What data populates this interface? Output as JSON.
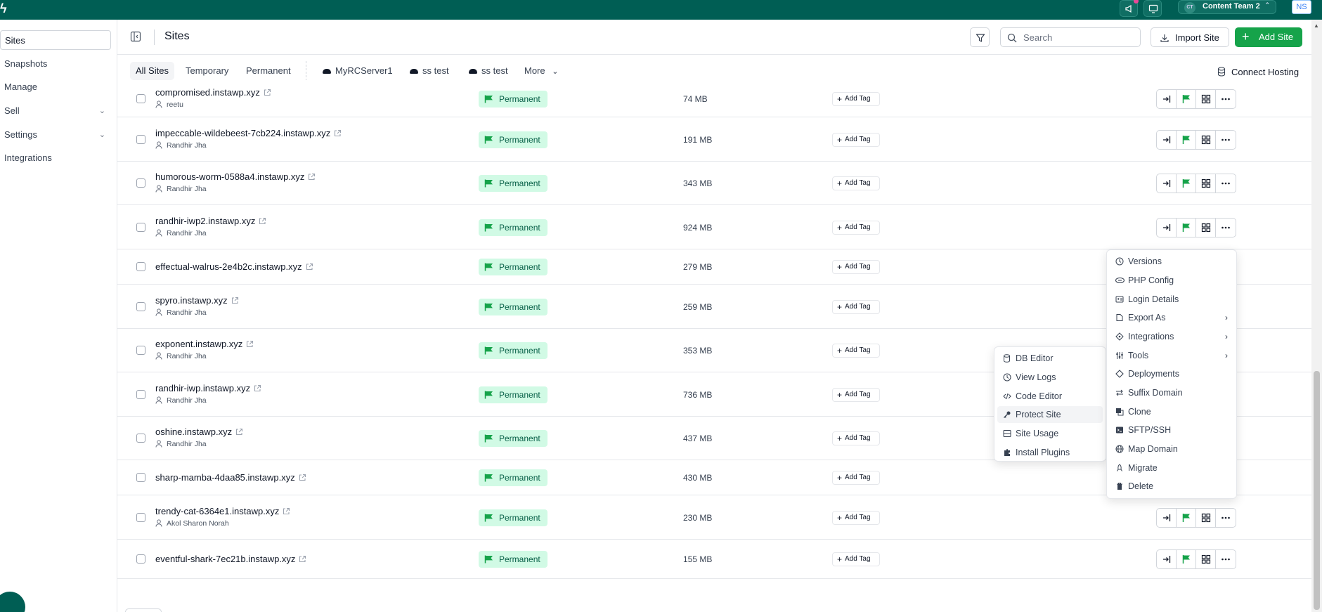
{
  "topbar": {
    "logo": "ϟ",
    "team_avatar": "CT",
    "team_name": "Content Team 2",
    "user_initials": "NS"
  },
  "sidebar": {
    "items": [
      {
        "label": "Sites"
      },
      {
        "label": "Snapshots"
      },
      {
        "label": "Manage"
      },
      {
        "label": "Sell"
      },
      {
        "label": "Settings"
      },
      {
        "label": "Integrations"
      }
    ]
  },
  "header": {
    "title": "Sites",
    "search_placeholder": "Search",
    "import_label": "Import Site",
    "add_label": "Add Site"
  },
  "tabs": {
    "all": "All Sites",
    "temporary": "Temporary",
    "permanent": "Permanent",
    "servers": [
      "MyRCServer1",
      "ss test",
      "ss test"
    ],
    "more": "More",
    "connect": "Connect Hosting"
  },
  "sites": [
    {
      "name": "compromised.instawp.xyz",
      "owner": "reetu",
      "status": "Permanent",
      "size": "74 MB",
      "tag": "Add Tag"
    },
    {
      "name": "impeccable-wildebeest-7cb224.instawp.xyz",
      "owner": "Randhir Jha",
      "status": "Permanent",
      "size": "191 MB",
      "tag": "Add Tag"
    },
    {
      "name": "humorous-worm-0588a4.instawp.xyz",
      "owner": "Randhir Jha",
      "status": "Permanent",
      "size": "343 MB",
      "tag": "Add Tag"
    },
    {
      "name": "randhir-iwp2.instawp.xyz",
      "owner": "Randhir Jha",
      "status": "Permanent",
      "size": "924 MB",
      "tag": "Add Tag"
    },
    {
      "name": "effectual-walrus-2e4b2c.instawp.xyz",
      "owner": "",
      "status": "Permanent",
      "size": "279 MB",
      "tag": "Add Tag"
    },
    {
      "name": "spyro.instawp.xyz",
      "owner": "Randhir Jha",
      "status": "Permanent",
      "size": "259 MB",
      "tag": "Add Tag"
    },
    {
      "name": "exponent.instawp.xyz",
      "owner": "Randhir Jha",
      "status": "Permanent",
      "size": "353 MB",
      "tag": "Add Tag"
    },
    {
      "name": "randhir-iwp.instawp.xyz",
      "owner": "Randhir Jha",
      "status": "Permanent",
      "size": "736 MB",
      "tag": "Add Tag"
    },
    {
      "name": "oshine.instawp.xyz",
      "owner": "Randhir Jha",
      "status": "Permanent",
      "size": "437 MB",
      "tag": "Add Tag"
    },
    {
      "name": "sharp-mamba-4daa85.instawp.xyz",
      "owner": "",
      "status": "Permanent",
      "size": "430 MB",
      "tag": "Add Tag"
    },
    {
      "name": "trendy-cat-6364e1.instawp.xyz",
      "owner": "Akol Sharon Norah",
      "status": "Permanent",
      "size": "230 MB",
      "tag": "Add Tag"
    },
    {
      "name": "eventful-shark-7ec21b.instawp.xyz",
      "owner": "",
      "status": "Permanent",
      "size": "155 MB",
      "tag": "Add Tag"
    }
  ],
  "context_menu": {
    "items": [
      "Versions",
      "PHP Config",
      "Login Details",
      "Export As",
      "Integrations",
      "Tools",
      "Deployments",
      "Suffix Domain",
      "Clone",
      "SFTP/SSH",
      "Map Domain",
      "Migrate",
      "Delete"
    ]
  },
  "tools_submenu": {
    "items": [
      "DB Editor",
      "View Logs",
      "Code Editor",
      "Protect Site",
      "Site Usage",
      "Install Plugins"
    ]
  },
  "colors": {
    "brand": "#005e54",
    "primary_button": "#16a34a",
    "badge_bg": "#d1fae5",
    "badge_text": "#065f46"
  },
  "icons": [
    "collapse-sidebar-icon",
    "filter-icon",
    "search-icon",
    "download-icon",
    "plus-icon",
    "server-icon",
    "external-link-icon",
    "user-icon",
    "flag-icon",
    "login-icon",
    "grid-icon",
    "more-icon"
  ]
}
